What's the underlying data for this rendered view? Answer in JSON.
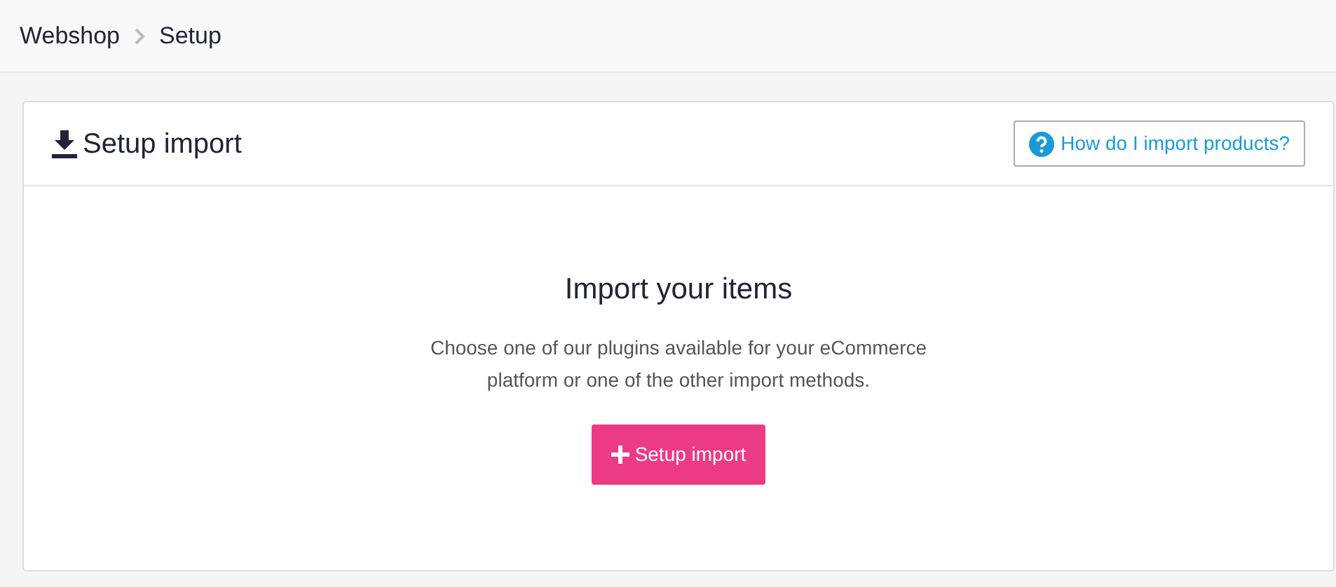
{
  "breadcrumb": [
    {
      "label": "Webshop"
    },
    {
      "label": "Setup"
    }
  ],
  "panel": {
    "title": "Setup import",
    "help_button": "How do I import products?"
  },
  "empty_state": {
    "heading": "Import your items",
    "text": "Choose one of our plugins available for your eCommerce platform or one of the other import methods.",
    "button": "Setup import"
  }
}
